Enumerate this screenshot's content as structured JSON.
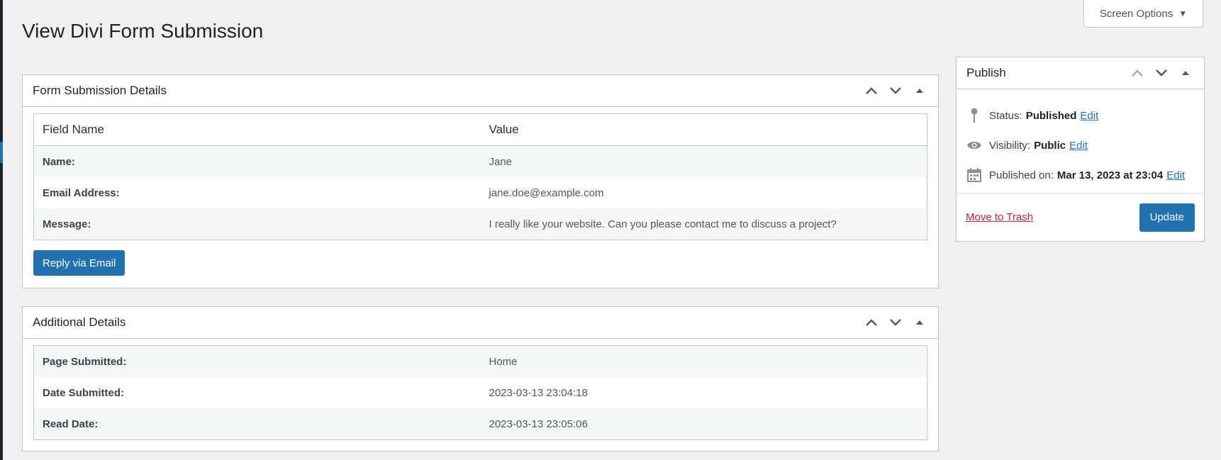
{
  "page": {
    "title": "View Divi Form Submission"
  },
  "screen_options": {
    "label": "Screen Options",
    "caret": "▼"
  },
  "form_details": {
    "title": "Form Submission Details",
    "col_field": "Field Name",
    "col_value": "Value",
    "rows": [
      {
        "label": "Name:",
        "value": "Jane"
      },
      {
        "label": "Email Address:",
        "value": "jane.doe@example.com"
      },
      {
        "label": "Message:",
        "value": "I really like your website. Can you please contact me to discuss a project?"
      }
    ],
    "reply_label": "Reply via Email"
  },
  "additional": {
    "title": "Additional Details",
    "rows": [
      {
        "label": "Page Submitted:",
        "value": "Home"
      },
      {
        "label": "Date Submitted:",
        "value": "2023-03-13 23:04:18"
      },
      {
        "label": "Read Date:",
        "value": "2023-03-13 23:05:06"
      }
    ]
  },
  "publish": {
    "title": "Publish",
    "status_label": "Status:",
    "status_value": "Published",
    "visibility_label": "Visibility:",
    "visibility_value": "Public",
    "published_label": "Published on:",
    "published_value": "Mar 13, 2023 at 23:04",
    "edit_label": "Edit",
    "trash_label": "Move to Trash",
    "update_label": "Update"
  },
  "colors": {
    "accent": "#2271b1",
    "danger": "#b32d2e",
    "background": "#f0f0f1"
  },
  "icons": [
    "arrow-up-icon",
    "arrow-down-icon",
    "toggle-triangle-icon",
    "pin-icon",
    "eye-icon",
    "calendar-icon"
  ]
}
